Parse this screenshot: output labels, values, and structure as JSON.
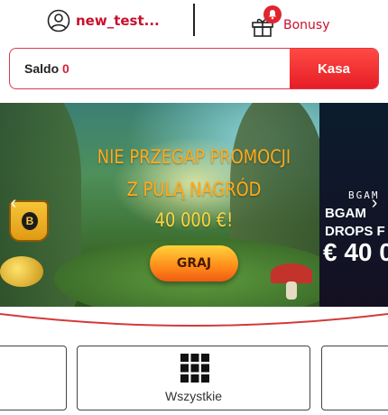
{
  "header": {
    "username": "new_test...",
    "user_icon": "user-circle-icon",
    "bonus_label": "Bonusy",
    "gift_icon": "gift-icon",
    "notification_icon": "bell-icon"
  },
  "balance": {
    "label": "Saldo",
    "value": "0",
    "cashier_button": "Kasa"
  },
  "banner": {
    "line1": "NIE PRZEGAP PROMOCJI",
    "line2": "Z PULĄ NAGRÓD",
    "line3": "40 000 €!",
    "cta_label": "GRAJ",
    "mug_letter": "B",
    "prev_arrow": "‹",
    "next_arrow": "›",
    "next_slide": {
      "line1": "BGAM",
      "line2": "BGAM",
      "line3": "DROPS F",
      "line4": "€ 40 0"
    }
  },
  "categories": {
    "selected_label": "Wszystkie",
    "selected_icon": "grid-icon"
  },
  "colors": {
    "accent": "#c8102e",
    "cashier": "#e51d26",
    "cta": "#ff8a1a",
    "banner_text": "#ffab1c"
  }
}
